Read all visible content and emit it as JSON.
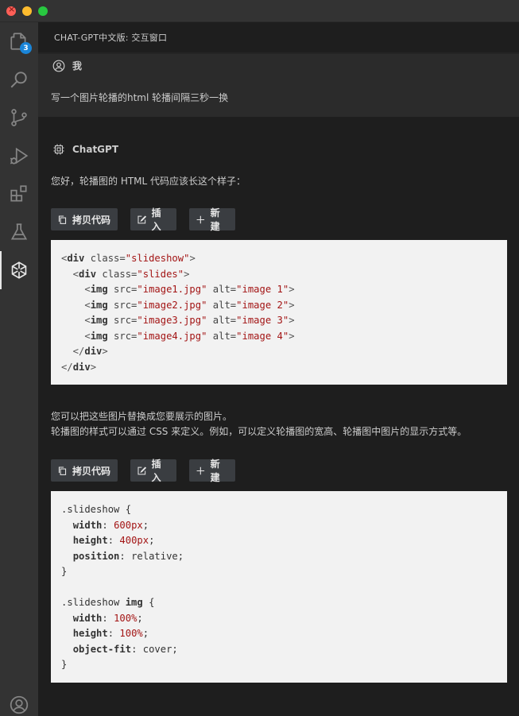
{
  "window": {
    "panel_title": "CHAT-GPT中文版: 交互窗口"
  },
  "activity_bar": {
    "explorer_badge": "3",
    "items": [
      "explorer-icon",
      "search-icon",
      "source-control-icon",
      "run-debug-icon",
      "extensions-icon",
      "testing-icon",
      "chatgpt-icon",
      "account-icon"
    ]
  },
  "conversation": {
    "user": {
      "name": "我",
      "message": "写一个图片轮播的html 轮播间隔三秒一换"
    },
    "bot": {
      "name": "ChatGPT",
      "intro": "您好，轮播图的 HTML 代码应该长这个样子：",
      "explain_line1": "您可以把这些图片替换成您要展示的图片。",
      "explain_line2": "轮播图的样式可以通过 CSS 来定义。例如，可以定义轮播图的宽高、轮播图中图片的显示方式等。"
    }
  },
  "code_actions": {
    "copy": "拷贝代码",
    "insert": "插入",
    "new": "新建"
  },
  "code_html": {
    "lines": [
      [
        {
          "t": "pun",
          "v": "<"
        },
        {
          "t": "tag",
          "v": "div"
        },
        {
          "t": "attr",
          "v": " class="
        },
        {
          "t": "str",
          "v": "\"slideshow\""
        },
        {
          "t": "pun",
          "v": ">"
        }
      ],
      [
        {
          "t": "pun",
          "v": "  <"
        },
        {
          "t": "tag",
          "v": "div"
        },
        {
          "t": "attr",
          "v": " class="
        },
        {
          "t": "str",
          "v": "\"slides\""
        },
        {
          "t": "pun",
          "v": ">"
        }
      ],
      [
        {
          "t": "pun",
          "v": "    <"
        },
        {
          "t": "tag",
          "v": "img"
        },
        {
          "t": "attr",
          "v": " src="
        },
        {
          "t": "str",
          "v": "\"image1.jpg\""
        },
        {
          "t": "attr",
          "v": " alt="
        },
        {
          "t": "str",
          "v": "\"image 1\""
        },
        {
          "t": "pun",
          "v": ">"
        }
      ],
      [
        {
          "t": "pun",
          "v": "    <"
        },
        {
          "t": "tag",
          "v": "img"
        },
        {
          "t": "attr",
          "v": " src="
        },
        {
          "t": "str",
          "v": "\"image2.jpg\""
        },
        {
          "t": "attr",
          "v": " alt="
        },
        {
          "t": "str",
          "v": "\"image 2\""
        },
        {
          "t": "pun",
          "v": ">"
        }
      ],
      [
        {
          "t": "pun",
          "v": "    <"
        },
        {
          "t": "tag",
          "v": "img"
        },
        {
          "t": "attr",
          "v": " src="
        },
        {
          "t": "str",
          "v": "\"image3.jpg\""
        },
        {
          "t": "attr",
          "v": " alt="
        },
        {
          "t": "str",
          "v": "\"image 3\""
        },
        {
          "t": "pun",
          "v": ">"
        }
      ],
      [
        {
          "t": "pun",
          "v": "    <"
        },
        {
          "t": "tag",
          "v": "img"
        },
        {
          "t": "attr",
          "v": " src="
        },
        {
          "t": "str",
          "v": "\"image4.jpg\""
        },
        {
          "t": "attr",
          "v": " alt="
        },
        {
          "t": "str",
          "v": "\"image 4\""
        },
        {
          "t": "pun",
          "v": ">"
        }
      ],
      [
        {
          "t": "pun",
          "v": "  </"
        },
        {
          "t": "tag",
          "v": "div"
        },
        {
          "t": "pun",
          "v": ">"
        }
      ],
      [
        {
          "t": "pun",
          "v": "</"
        },
        {
          "t": "tag",
          "v": "div"
        },
        {
          "t": "pun",
          "v": ">"
        }
      ]
    ]
  },
  "code_css": {
    "lines": [
      [
        {
          "t": "sel",
          "v": ".slideshow {"
        }
      ],
      [
        {
          "t": "sel",
          "v": "  "
        },
        {
          "t": "prop",
          "v": "width"
        },
        {
          "t": "sel",
          "v": ": "
        },
        {
          "t": "num",
          "v": "600px"
        },
        {
          "t": "sel",
          "v": ";"
        }
      ],
      [
        {
          "t": "sel",
          "v": "  "
        },
        {
          "t": "prop",
          "v": "height"
        },
        {
          "t": "sel",
          "v": ": "
        },
        {
          "t": "num",
          "v": "400px"
        },
        {
          "t": "sel",
          "v": ";"
        }
      ],
      [
        {
          "t": "sel",
          "v": "  "
        },
        {
          "t": "prop",
          "v": "position"
        },
        {
          "t": "sel",
          "v": ": relative;"
        }
      ],
      [
        {
          "t": "sel",
          "v": "}"
        }
      ],
      [
        {
          "t": "sel",
          "v": ""
        }
      ],
      [
        {
          "t": "sel",
          "v": ".slideshow "
        },
        {
          "t": "prop",
          "v": "img"
        },
        {
          "t": "sel",
          "v": " {"
        }
      ],
      [
        {
          "t": "sel",
          "v": "  "
        },
        {
          "t": "prop",
          "v": "width"
        },
        {
          "t": "sel",
          "v": ": "
        },
        {
          "t": "num",
          "v": "100%"
        },
        {
          "t": "sel",
          "v": ";"
        }
      ],
      [
        {
          "t": "sel",
          "v": "  "
        },
        {
          "t": "prop",
          "v": "height"
        },
        {
          "t": "sel",
          "v": ": "
        },
        {
          "t": "num",
          "v": "100%"
        },
        {
          "t": "sel",
          "v": ";"
        }
      ],
      [
        {
          "t": "sel",
          "v": "  "
        },
        {
          "t": "prop",
          "v": "object-fit"
        },
        {
          "t": "sel",
          "v": ": cover;"
        }
      ],
      [
        {
          "t": "sel",
          "v": "}"
        }
      ]
    ]
  }
}
